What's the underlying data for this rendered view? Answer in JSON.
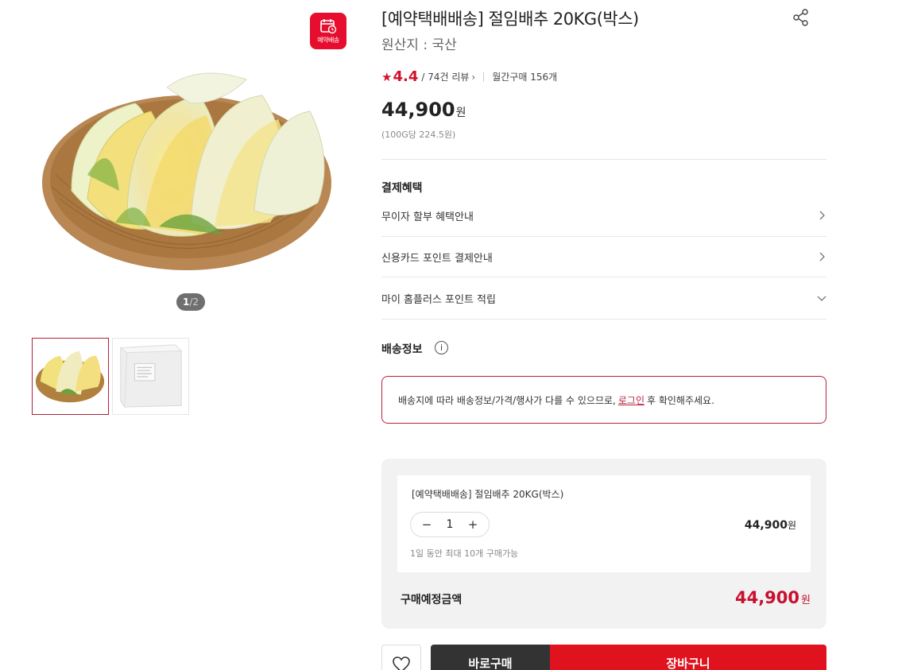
{
  "badge": {
    "text": "예약배송",
    "icon": "calendar-clock-icon",
    "color": "#e60d2e"
  },
  "gallery": {
    "counter_current": "1",
    "counter_total": "/2",
    "main_image": "salted-napa-cabbage-in-basket",
    "thumbnails": [
      "cabbage-basket-thumbnail",
      "styrofoam-box-thumbnail"
    ]
  },
  "product": {
    "title": "[예약택배배송] 절임배추 20KG(박스)",
    "origin": "원산지 : 국산",
    "rating": "4.4",
    "reviews": "/ 74건 리뷰",
    "monthly_purchases": "월간구매 156개",
    "price": "44,900",
    "price_unit": "원",
    "unit_price": "(100G당 224.5원)"
  },
  "benefits": {
    "title": "결제혜택",
    "items": [
      {
        "label": "무이자 할부 혜택안내"
      },
      {
        "label": "신용카드 포인트 결제안내"
      },
      {
        "label": "마이 홈플러스 포인트 적립"
      }
    ]
  },
  "shipping": {
    "title": "배송정보",
    "notice_before": "배송지에 따라 배송정보/가격/행사가 다를 수 있으므로,",
    "notice_link": "로그인",
    "notice_after": "후 확인해주세요."
  },
  "order": {
    "item_name": "[예약택배배송] 절임배추 20KG(박스)",
    "quantity": "1",
    "minus": "−",
    "plus": "+",
    "item_price": "44,900",
    "price_unit": "원",
    "limit_text": "1일 동안 최대 10개 구매가능",
    "total_label": "구매예정금액",
    "total_price": "44,900",
    "total_unit": "원"
  },
  "actions": {
    "buy_now": "바로구매",
    "cart": "장바구니",
    "wish_icon": "heart-icon"
  },
  "colors": {
    "accent": "#c8102e",
    "cart_button": "#e0121e",
    "buy_button": "#333333"
  }
}
